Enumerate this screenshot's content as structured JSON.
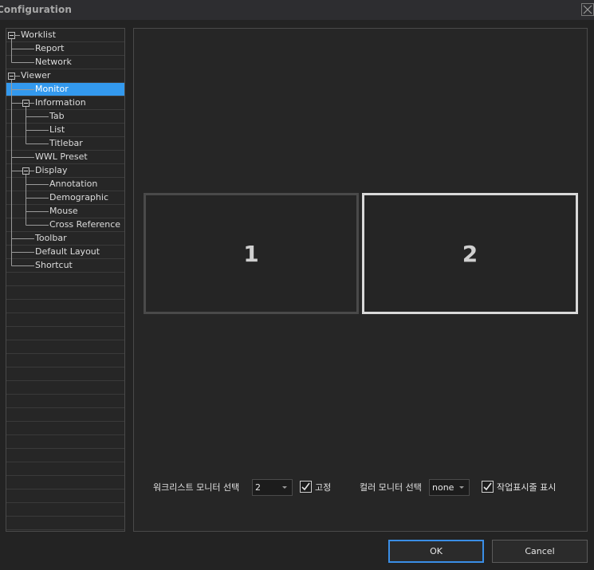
{
  "window": {
    "title": "Configuration"
  },
  "tree": {
    "items": [
      {
        "label": "Worklist",
        "level": 0,
        "expandable": true
      },
      {
        "label": "Report",
        "level": 1
      },
      {
        "label": "Network",
        "level": 1
      },
      {
        "label": "Viewer",
        "level": 0,
        "expandable": true
      },
      {
        "label": "Monitor",
        "level": 1,
        "selected": true
      },
      {
        "label": "Information",
        "level": 1,
        "expandable": true
      },
      {
        "label": "Tab",
        "level": 2
      },
      {
        "label": "List",
        "level": 2
      },
      {
        "label": "Titlebar",
        "level": 2
      },
      {
        "label": "WWL Preset",
        "level": 1
      },
      {
        "label": "Display",
        "level": 1,
        "expandable": true
      },
      {
        "label": "Annotation",
        "level": 2
      },
      {
        "label": "Demographic",
        "level": 2
      },
      {
        "label": "Mouse",
        "level": 2
      },
      {
        "label": "Cross Reference",
        "level": 2
      },
      {
        "label": "Toolbar",
        "level": 1
      },
      {
        "label": "Default Layout",
        "level": 1
      },
      {
        "label": "Shortcut",
        "level": 1
      }
    ]
  },
  "monitors": [
    {
      "label": "1",
      "selected": false
    },
    {
      "label": "2",
      "selected": true
    }
  ],
  "options": {
    "worklist_monitor_label": "워크리스트 모니터 선택",
    "worklist_monitor_value": "2",
    "fixed_label": "고정",
    "fixed_checked": true,
    "color_monitor_label": "컬러 모니터 선택",
    "color_monitor_value": "none",
    "taskbar_label": "작업표시줄 표시",
    "taskbar_checked": true
  },
  "buttons": {
    "ok": "OK",
    "cancel": "Cancel"
  },
  "colors": {
    "selection": "#3399ee",
    "accent_border": "#3a8ee6",
    "background": "#232323"
  }
}
